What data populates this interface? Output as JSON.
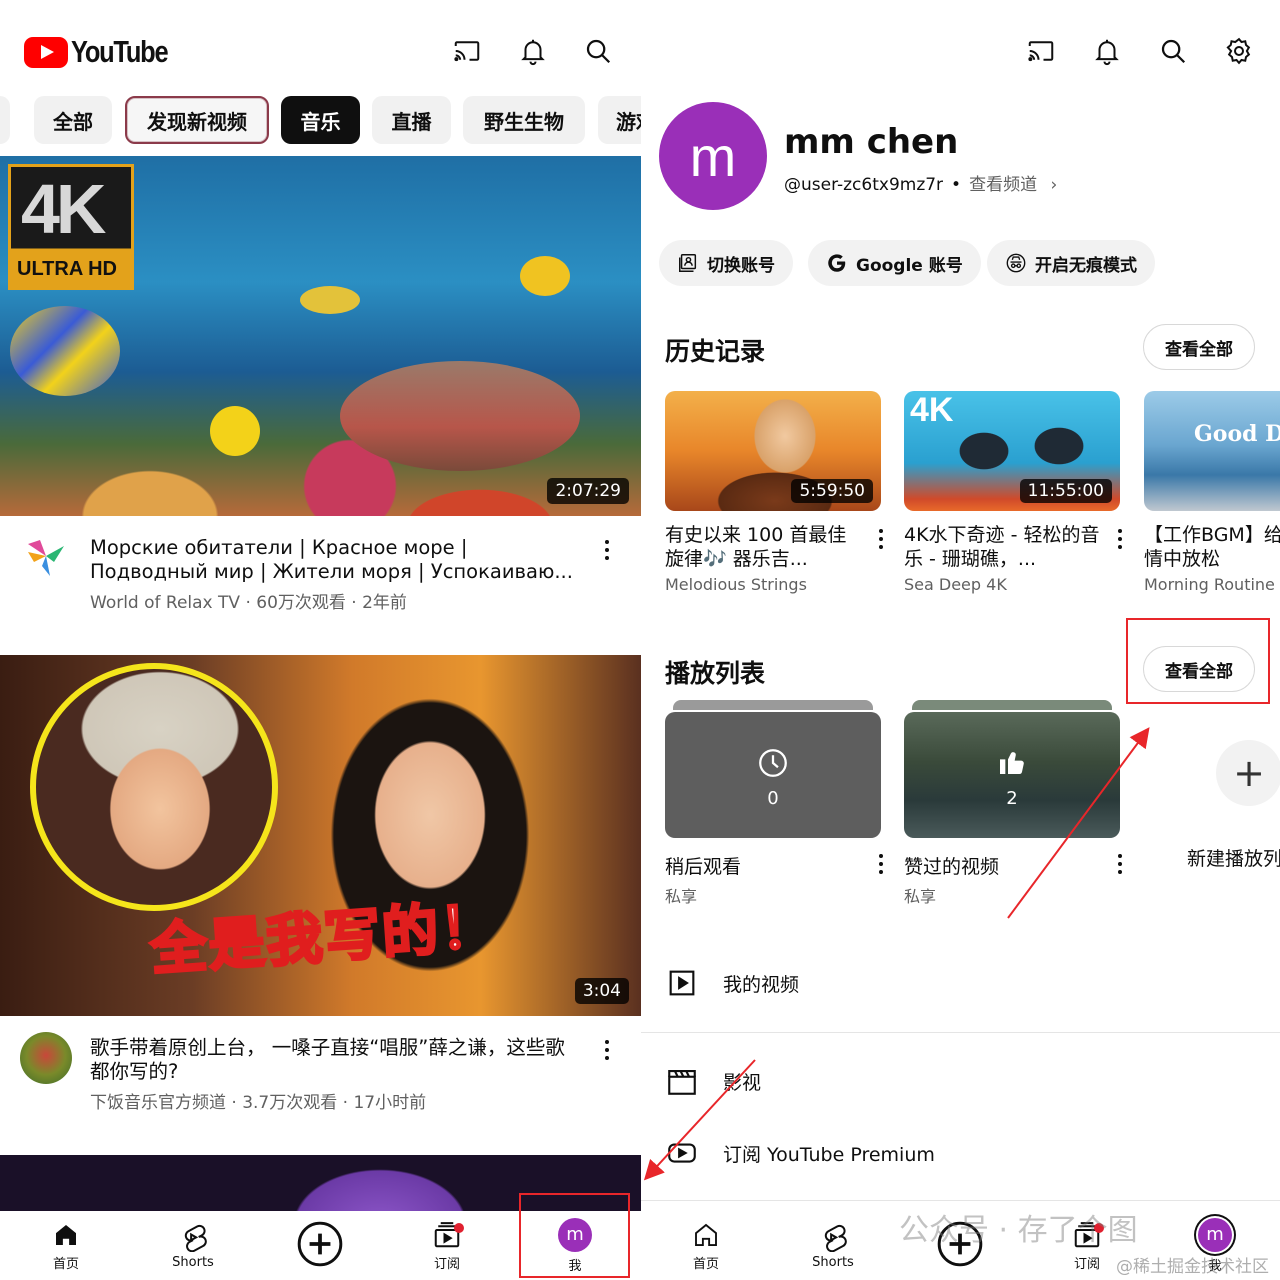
{
  "left": {
    "logo_text": "YouTube",
    "chips": [
      "全部",
      "发现新视频",
      "音乐",
      "直播",
      "野生生物",
      "游戏"
    ],
    "videos": [
      {
        "badge_big": "4K",
        "badge_small": "ULTRA HD",
        "duration": "2:07:29",
        "title": "Морские обитатели | Красное море | Подводный мир | Жители моря | Успокаиваю...",
        "subtitle": "World of Relax TV · 60万次观看 · 2年前"
      },
      {
        "caption": "全是我写的！",
        "duration": "3:04",
        "title": "歌手带着原创上台，  一嗓子直接“唱服”薛之谦，这些歌都你写的?",
        "subtitle": "下饭音乐官方频道 · 3.7万次观看 · 17小时前"
      }
    ],
    "nav": [
      "首页",
      "Shorts",
      "",
      "订阅",
      "我"
    ],
    "me_initial": "m"
  },
  "right": {
    "profile": {
      "initial": "m",
      "name": "mm chen",
      "handle": "@user-zc6tx9mz7r",
      "separator": "•",
      "view_channel": "查看频道",
      "chevron": "›"
    },
    "pills": [
      "切换账号",
      "Google 账号",
      "开启无痕模式"
    ],
    "history": {
      "title": "历史记录",
      "view_all": "查看全部",
      "items": [
        {
          "duration": "5:59:50",
          "title": "有史以来 100 首最佳旋律🎶 器乐吉...",
          "channel": "Melodious Strings"
        },
        {
          "duration": "11:55:00",
          "title": "4K水下奇迹 - 轻松的音乐 - 珊瑚礁，...",
          "channel": "Sea Deep 4K",
          "badge": "4K"
        },
        {
          "duration": "",
          "title": "【工作BGM】给清爽心情中放松",
          "channel": "Morning Routine",
          "overlay": "Good D"
        }
      ]
    },
    "playlists": {
      "title": "播放列表",
      "view_all": "查看全部",
      "items": [
        {
          "count": "0",
          "title": "稍后观看",
          "privacy": "私享"
        },
        {
          "count": "2",
          "title": "赞过的视频",
          "privacy": "私享"
        }
      ],
      "new_label": "新建播放列表",
      "new_icon": "+"
    },
    "rows": [
      "我的视频",
      "影视",
      "订阅 YouTube Premium"
    ],
    "nav": [
      "首页",
      "Shorts",
      "",
      "订阅",
      "我"
    ],
    "me_initial": "m",
    "watermark": "公众号 · 存了个图",
    "watermark2": "@稀土掘金技术社区"
  },
  "colors": {
    "brand_red": "#ff0000",
    "avatar_purple": "#9a2fb8",
    "annotation_red": "#e8262a"
  }
}
